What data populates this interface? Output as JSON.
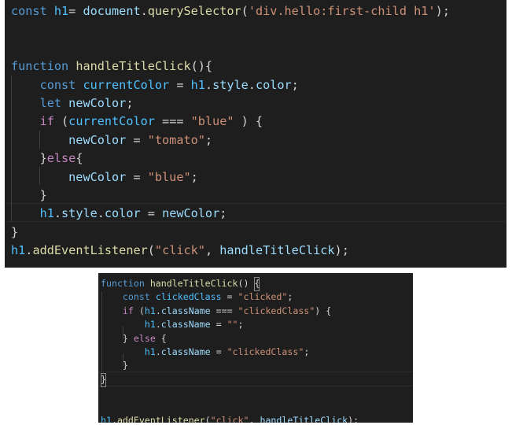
{
  "editor_top": {
    "lines": [
      [
        {
          "t": "const",
          "c": "kw"
        },
        {
          "t": " ",
          "c": "op"
        },
        {
          "t": "h1",
          "c": "cst"
        },
        {
          "t": "= ",
          "c": "op"
        },
        {
          "t": "document",
          "c": "var"
        },
        {
          "t": ".",
          "c": "op"
        },
        {
          "t": "querySelector",
          "c": "fn"
        },
        {
          "t": "(",
          "c": "op"
        },
        {
          "t": "'div.hello:first-child h1'",
          "c": "str"
        },
        {
          "t": ");",
          "c": "op"
        }
      ],
      [],
      [],
      [
        {
          "t": "function",
          "c": "kw"
        },
        {
          "t": " ",
          "c": "op"
        },
        {
          "t": "handleTitleClick",
          "c": "fn"
        },
        {
          "t": "(){",
          "c": "op"
        }
      ],
      [
        {
          "t": "    ",
          "c": "op"
        },
        {
          "t": "const",
          "c": "kw"
        },
        {
          "t": " ",
          "c": "op"
        },
        {
          "t": "currentColor",
          "c": "cst"
        },
        {
          "t": " = ",
          "c": "op"
        },
        {
          "t": "h1",
          "c": "cst"
        },
        {
          "t": ".",
          "c": "op"
        },
        {
          "t": "style",
          "c": "var"
        },
        {
          "t": ".",
          "c": "op"
        },
        {
          "t": "color",
          "c": "var"
        },
        {
          "t": ";",
          "c": "op"
        }
      ],
      [
        {
          "t": "    ",
          "c": "op"
        },
        {
          "t": "let",
          "c": "kw"
        },
        {
          "t": " ",
          "c": "op"
        },
        {
          "t": "newColor",
          "c": "var"
        },
        {
          "t": ";",
          "c": "op"
        }
      ],
      [
        {
          "t": "    ",
          "c": "op"
        },
        {
          "t": "if",
          "c": "ctl"
        },
        {
          "t": " (",
          "c": "op"
        },
        {
          "t": "currentColor",
          "c": "cst"
        },
        {
          "t": " === ",
          "c": "op"
        },
        {
          "t": "\"blue\"",
          "c": "str"
        },
        {
          "t": " ) {",
          "c": "op"
        }
      ],
      [
        {
          "t": "        ",
          "c": "op"
        },
        {
          "t": "newColor",
          "c": "var"
        },
        {
          "t": " = ",
          "c": "op"
        },
        {
          "t": "\"tomato\"",
          "c": "str"
        },
        {
          "t": ";",
          "c": "op"
        }
      ],
      [
        {
          "t": "    }",
          "c": "op"
        },
        {
          "t": "else",
          "c": "ctl"
        },
        {
          "t": "{",
          "c": "op"
        }
      ],
      [
        {
          "t": "        ",
          "c": "op"
        },
        {
          "t": "newColor",
          "c": "var"
        },
        {
          "t": " = ",
          "c": "op"
        },
        {
          "t": "\"blue\"",
          "c": "str"
        },
        {
          "t": ";",
          "c": "op"
        }
      ],
      [
        {
          "t": "    }",
          "c": "op"
        }
      ],
      [
        {
          "t": "    ",
          "c": "op"
        },
        {
          "t": "h1",
          "c": "cst"
        },
        {
          "t": ".",
          "c": "op"
        },
        {
          "t": "style",
          "c": "var"
        },
        {
          "t": ".",
          "c": "op"
        },
        {
          "t": "color",
          "c": "var"
        },
        {
          "t": " = ",
          "c": "op"
        },
        {
          "t": "newColor",
          "c": "var"
        },
        {
          "t": ";",
          "c": "op"
        }
      ],
      [
        {
          "t": "}",
          "c": "op"
        }
      ],
      [
        {
          "t": "h1",
          "c": "cst"
        },
        {
          "t": ".",
          "c": "op"
        },
        {
          "t": "addEventListener",
          "c": "fn"
        },
        {
          "t": "(",
          "c": "op"
        },
        {
          "t": "\"click\"",
          "c": "str"
        },
        {
          "t": ", ",
          "c": "op"
        },
        {
          "t": "handleTitleClick",
          "c": "var"
        },
        {
          "t": ");",
          "c": "op"
        }
      ]
    ]
  },
  "editor_bottom": {
    "lines": [
      [
        {
          "t": "function",
          "c": "kw"
        },
        {
          "t": " ",
          "c": "op"
        },
        {
          "t": "handleTitleClick",
          "c": "fn"
        },
        {
          "t": "() ",
          "c": "op"
        },
        {
          "t": "{",
          "c": "op"
        }
      ],
      [
        {
          "t": "    ",
          "c": "op"
        },
        {
          "t": "const",
          "c": "kw"
        },
        {
          "t": " ",
          "c": "op"
        },
        {
          "t": "clickedClass",
          "c": "cst"
        },
        {
          "t": " = ",
          "c": "op"
        },
        {
          "t": "\"clicked\"",
          "c": "str"
        },
        {
          "t": ";",
          "c": "op"
        }
      ],
      [
        {
          "t": "    ",
          "c": "op"
        },
        {
          "t": "if",
          "c": "ctl"
        },
        {
          "t": " (",
          "c": "op"
        },
        {
          "t": "h1",
          "c": "cst"
        },
        {
          "t": ".",
          "c": "op"
        },
        {
          "t": "className",
          "c": "var"
        },
        {
          "t": " === ",
          "c": "op"
        },
        {
          "t": "\"clickedClass\"",
          "c": "str"
        },
        {
          "t": ") {",
          "c": "op"
        }
      ],
      [
        {
          "t": "        ",
          "c": "op"
        },
        {
          "t": "h1",
          "c": "cst"
        },
        {
          "t": ".",
          "c": "op"
        },
        {
          "t": "className",
          "c": "var"
        },
        {
          "t": " = ",
          "c": "op"
        },
        {
          "t": "\"\"",
          "c": "str"
        },
        {
          "t": ";",
          "c": "op"
        }
      ],
      [
        {
          "t": "    } ",
          "c": "op"
        },
        {
          "t": "else",
          "c": "ctl"
        },
        {
          "t": " {",
          "c": "op"
        }
      ],
      [
        {
          "t": "        ",
          "c": "op"
        },
        {
          "t": "h1",
          "c": "cst"
        },
        {
          "t": ".",
          "c": "op"
        },
        {
          "t": "className",
          "c": "var"
        },
        {
          "t": " = ",
          "c": "op"
        },
        {
          "t": "\"clickedClass\"",
          "c": "str"
        },
        {
          "t": ";",
          "c": "op"
        }
      ],
      [
        {
          "t": "    }",
          "c": "op"
        }
      ],
      [
        {
          "t": "}",
          "c": "op"
        }
      ],
      [],
      [],
      [
        {
          "t": "h1",
          "c": "cst"
        },
        {
          "t": ".",
          "c": "op"
        },
        {
          "t": "addEventListener",
          "c": "fn"
        },
        {
          "t": "(",
          "c": "op"
        },
        {
          "t": "\"click\"",
          "c": "str"
        },
        {
          "t": ", ",
          "c": "op"
        },
        {
          "t": "handleTitleClick",
          "c": "var"
        },
        {
          "t": ");",
          "c": "op"
        }
      ]
    ]
  },
  "colors": {
    "background": "#1e1e1e",
    "keyword": "#569cd6",
    "control": "#c586c0",
    "function": "#dcdcaa",
    "variable": "#9cdcfe",
    "constant": "#4fc1ff",
    "string": "#ce9178",
    "operator": "#d4d4d4"
  }
}
